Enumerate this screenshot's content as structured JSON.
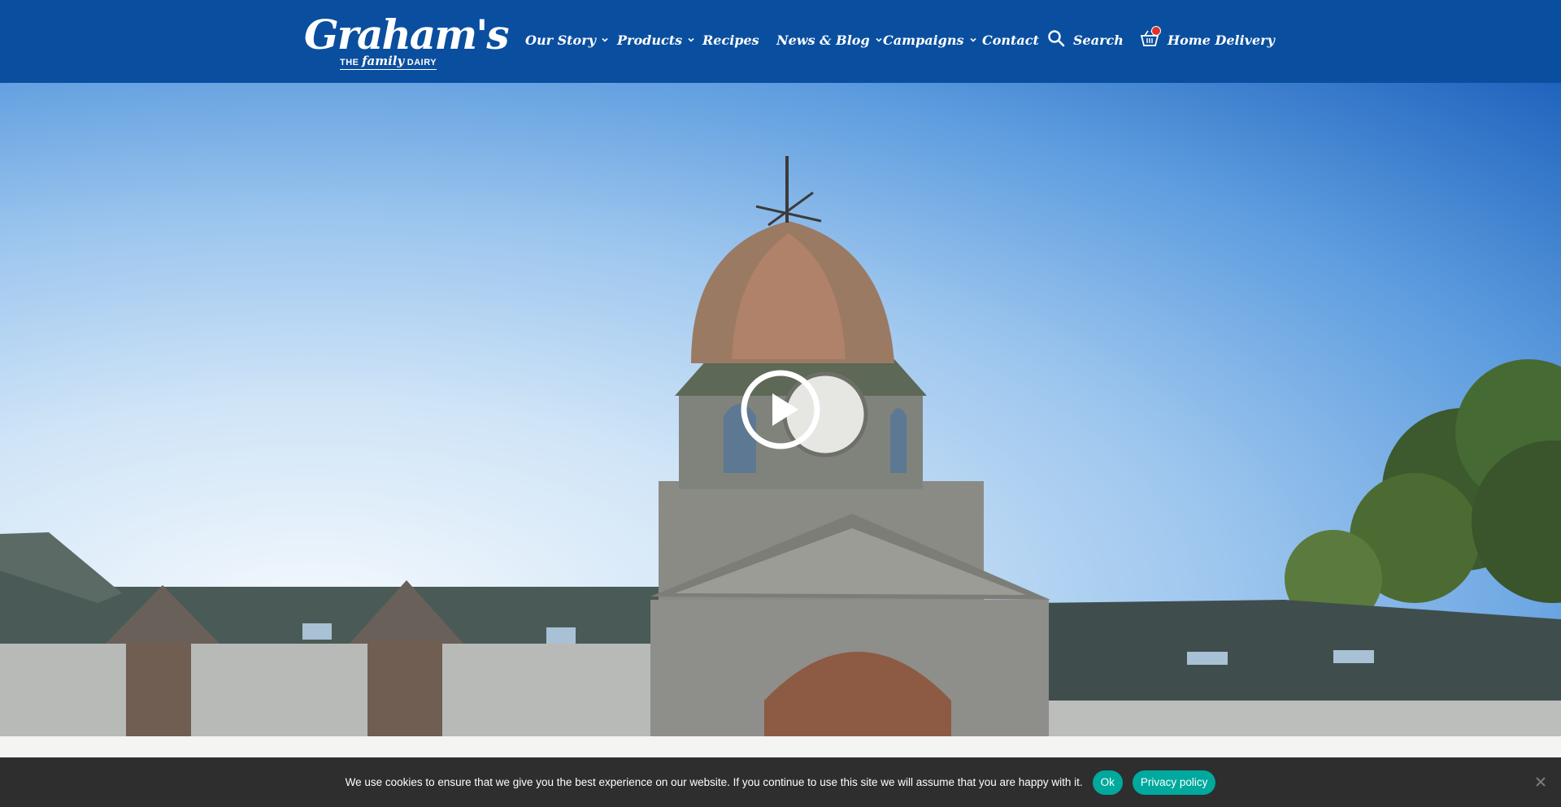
{
  "header": {
    "logo": {
      "name": "Graham's",
      "tagline_pre": "THE",
      "tagline_family": "family",
      "tagline_post": "DAIRY"
    },
    "nav": [
      {
        "label": "Our Story",
        "dropdown": true
      },
      {
        "label": "Products",
        "dropdown": true
      },
      {
        "label": "Recipes",
        "dropdown": false
      },
      {
        "label": "News & Blog",
        "dropdown": true
      },
      {
        "label": "Campaigns",
        "dropdown": true
      },
      {
        "label": "Contact",
        "dropdown": false
      }
    ],
    "search_label": "Search",
    "delivery_label": "Home Delivery",
    "colors": {
      "header_bg": "#0a4f9f",
      "basket_badge": "#e0312b"
    }
  },
  "hero": {
    "image": "farm clock tower with weathervane against blue sky",
    "play_icon": "play-circle-icon"
  },
  "cookie_bar": {
    "message": "We use cookies to ensure that we give you the best experience on our website. If you continue to use this site we will assume that you are happy with it.",
    "ok_label": "Ok",
    "privacy_label": "Privacy policy",
    "colors": {
      "bg": "#2e2e2e",
      "button": "#00a99d"
    }
  }
}
